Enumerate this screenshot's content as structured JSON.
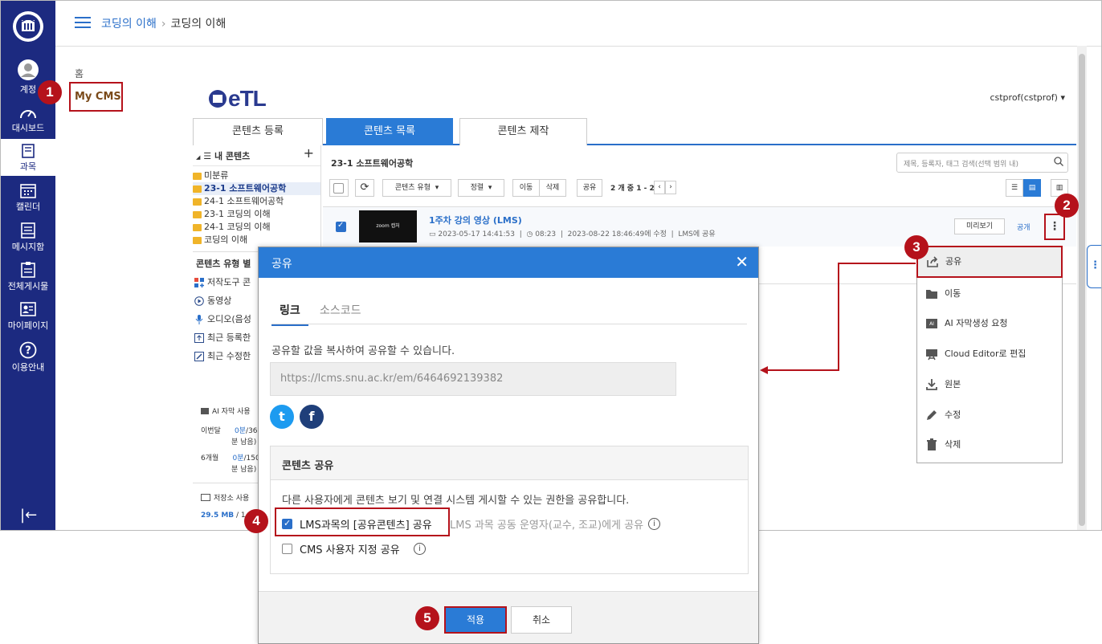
{
  "sidebar": {
    "items": [
      {
        "label": "계정",
        "icon": "account-icon"
      },
      {
        "label": "대시보드",
        "icon": "dashboard-icon"
      },
      {
        "label": "과목",
        "icon": "course-icon"
      },
      {
        "label": "캘린더",
        "icon": "calendar-icon"
      },
      {
        "label": "메시지함",
        "icon": "message-icon"
      },
      {
        "label": "전체게시물",
        "icon": "board-icon"
      },
      {
        "label": "마이페이지",
        "icon": "mypage-icon"
      },
      {
        "label": "이용안내",
        "icon": "help-icon"
      }
    ],
    "collapse": "|←"
  },
  "topbar": {
    "breadcrumb_link": "코딩의 이해",
    "breadcrumb_sep": "›",
    "breadcrumb_current": "코딩의 이해"
  },
  "leftnav": {
    "home": "홈",
    "mycms": "My CMS"
  },
  "badges": [
    "1",
    "2",
    "3",
    "4",
    "5"
  ],
  "etl": {
    "logo": "eTL",
    "user": "cstprof(cstprof)",
    "user_caret": "▾",
    "tabs": [
      "콘텐츠 등록",
      "콘텐츠 목록",
      "콘텐츠 제작"
    ],
    "tree": {
      "header": "내 콘텐츠",
      "toggle": "◢",
      "plus": "+",
      "folders": [
        "미분류",
        "23-1 소프트웨어공학",
        "24-1 소프트웨어공학",
        "23-1 코딩의 이해",
        "24-1 코딩의 이해",
        "코딩의 이해"
      ],
      "types_header": "콘텐츠 유형 별",
      "types": [
        "저작도구 콘",
        "동영상",
        "오디오(음성",
        "최근 등록한",
        "최근 수정한"
      ],
      "ai_label": "AI 자막 사용",
      "month_label": "이번달",
      "month_used": "0분",
      "month_rest": "/36,0",
      "month_left": "분 남음)",
      "half_label": "6개월",
      "half_used": "0분",
      "half_rest": "/150",
      "half_left": "분 남음)",
      "storage_label": "저장소 사용",
      "storage_used": "29.5 MB",
      "storage_rest": " / 1"
    },
    "main": {
      "title": "23-1 소프트웨어공학",
      "search_placeholder": "제목, 등록자, 태그 검색(선택 범위 내)",
      "tools": {
        "type": "콘텐츠 유형",
        "sort": "정렬",
        "move": "이동",
        "delete": "삭제",
        "share": "공유",
        "count": "2 개 중 1 - 2",
        "caret": "▾",
        "prev": "‹",
        "next": "›"
      },
      "row": {
        "thumb": "zoom 캡처",
        "title": "1주차 강의 영상 (LMS)",
        "created": "2023-05-17 14:41:53",
        "duration": "08:23",
        "modified": "2023-08-22 18:46:49에 수정",
        "lms": "LMS에 공유",
        "preview": "미리보기",
        "public": "공개",
        "kebab": "⋮"
      }
    }
  },
  "menu": {
    "items": [
      {
        "label": "공유",
        "icon": "share-icon"
      },
      {
        "label": "이동",
        "icon": "folder-icon"
      },
      {
        "label": "AI 자막생성 요청",
        "icon": "ai-subtitle-icon"
      },
      {
        "label": "Cloud Editor로 편집",
        "icon": "cloud-editor-icon"
      },
      {
        "label": "원본",
        "icon": "download-icon"
      },
      {
        "label": "수정",
        "icon": "pencil-icon"
      },
      {
        "label": "삭제",
        "icon": "trash-icon"
      }
    ]
  },
  "modal": {
    "title": "공유",
    "close": "✕",
    "tabs": [
      "링크",
      "소스코드"
    ],
    "desc": "공유할 값을 복사하여 공유할 수 있습니다.",
    "url": "https://lcms.snu.ac.kr/em/6464692139382",
    "social": {
      "twitter": "t",
      "facebook": "f"
    },
    "share_header": "콘텐츠 공유",
    "share_desc": "다른 사용자에게 콘텐츠 보기 및 연결 시스템 게시할 수 있는 권한을 공유합니다.",
    "opt1": "LMS과목의 [공유콘텐츠] 공유",
    "opt1_hint": "LMS 과목 공동 운영자(교수, 조교)에게 공유",
    "opt2": "CMS 사용자 지정 공유",
    "info": "i",
    "apply": "적용",
    "cancel": "취소"
  },
  "colors": {
    "sidebar": "#1c2a80",
    "accent": "#2a7bd6",
    "highlight": "#b5121b"
  }
}
